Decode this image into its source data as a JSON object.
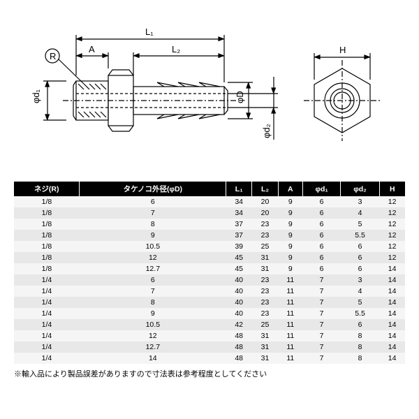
{
  "drawing": {
    "labels": {
      "L1": "L₁",
      "A": "A",
      "L2": "L₂",
      "R": "R",
      "phi_d1": "φd₁",
      "phi_D": "φD",
      "phi_d2": "φd₂",
      "H": "H"
    }
  },
  "table": {
    "headers": [
      "ネジ(R)",
      "タケノコ外径(φD)",
      "L₁",
      "L₂",
      "A",
      "φd₁",
      "φd₂",
      "H"
    ],
    "rows": [
      [
        "1/8",
        "6",
        "34",
        "20",
        "9",
        "6",
        "3",
        "12"
      ],
      [
        "1/8",
        "7",
        "34",
        "20",
        "9",
        "6",
        "4",
        "12"
      ],
      [
        "1/8",
        "8",
        "37",
        "23",
        "9",
        "6",
        "5",
        "12"
      ],
      [
        "1/8",
        "9",
        "37",
        "23",
        "9",
        "6",
        "5.5",
        "12"
      ],
      [
        "1/8",
        "10.5",
        "39",
        "25",
        "9",
        "6",
        "6",
        "12"
      ],
      [
        "1/8",
        "12",
        "45",
        "31",
        "9",
        "6",
        "6",
        "12"
      ],
      [
        "1/8",
        "12.7",
        "45",
        "31",
        "9",
        "6",
        "6",
        "14"
      ],
      [
        "1/4",
        "6",
        "40",
        "23",
        "11",
        "7",
        "3",
        "14"
      ],
      [
        "1/4",
        "7",
        "40",
        "23",
        "11",
        "7",
        "4",
        "14"
      ],
      [
        "1/4",
        "8",
        "40",
        "23",
        "11",
        "7",
        "5",
        "14"
      ],
      [
        "1/4",
        "9",
        "40",
        "23",
        "11",
        "7",
        "5.5",
        "14"
      ],
      [
        "1/4",
        "10.5",
        "42",
        "25",
        "11",
        "7",
        "6",
        "14"
      ],
      [
        "1/4",
        "12",
        "48",
        "31",
        "11",
        "7",
        "8",
        "14"
      ],
      [
        "1/4",
        "12.7",
        "48",
        "31",
        "11",
        "7",
        "8",
        "14"
      ],
      [
        "1/4",
        "14",
        "48",
        "31",
        "11",
        "7",
        "8",
        "14"
      ]
    ]
  },
  "note": "※輸入品により製品誤差がありますので寸法表は参考程度としてください"
}
